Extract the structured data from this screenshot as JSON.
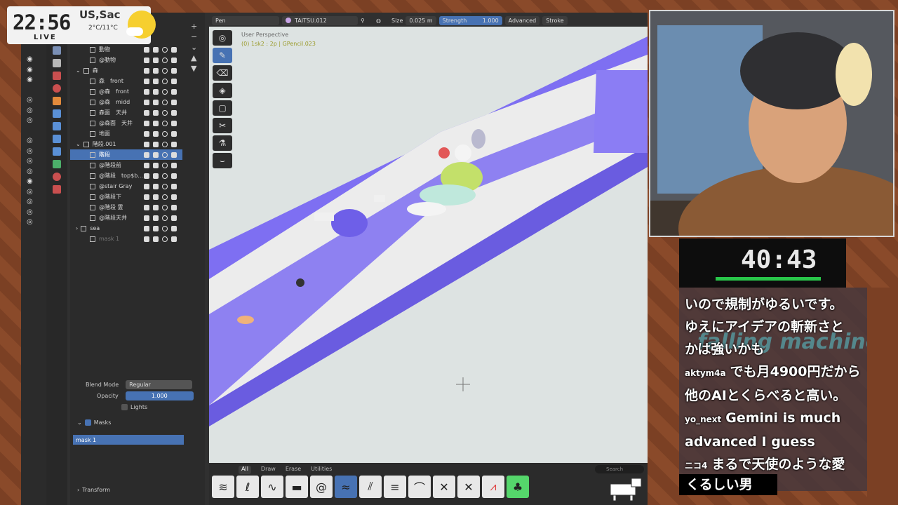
{
  "overlay": {
    "time": "22:56",
    "live": "LIVE",
    "location": "US,Sac",
    "temp": "2°C/11°C",
    "timer": "40:43",
    "progress": 0.75
  },
  "outliner": {
    "rows": [
      {
        "indent": 1,
        "label": "動物",
        "dim": false,
        "sel": false
      },
      {
        "indent": 1,
        "label": "@動物",
        "dim": false,
        "sel": false
      },
      {
        "indent": 0,
        "label": "森",
        "dim": false,
        "sel": false,
        "expand": "v"
      },
      {
        "indent": 1,
        "label": "森　front",
        "dim": false,
        "sel": false
      },
      {
        "indent": 1,
        "label": "@森　front",
        "dim": false,
        "sel": false
      },
      {
        "indent": 1,
        "label": "@森　midd",
        "dim": false,
        "sel": false
      },
      {
        "indent": 1,
        "label": "森面　天井",
        "dim": false,
        "sel": false
      },
      {
        "indent": 1,
        "label": "@森面　天井",
        "dim": false,
        "sel": false
      },
      {
        "indent": 1,
        "label": "地面",
        "dim": false,
        "sel": false
      },
      {
        "indent": 0,
        "label": "階段.001",
        "dim": false,
        "sel": false,
        "expand": "v"
      },
      {
        "indent": 1,
        "label": "階段",
        "dim": false,
        "sel": true
      },
      {
        "indent": 1,
        "label": "@階段前",
        "dim": false,
        "sel": false
      },
      {
        "indent": 1,
        "label": "@階段　top$b...",
        "dim": false,
        "sel": false
      },
      {
        "indent": 1,
        "label": "@stair Gray",
        "dim": false,
        "sel": false
      },
      {
        "indent": 1,
        "label": "@階段下",
        "dim": false,
        "sel": false
      },
      {
        "indent": 1,
        "label": "@階段 霊",
        "dim": false,
        "sel": false
      },
      {
        "indent": 1,
        "label": "@階段天井",
        "dim": false,
        "sel": false
      },
      {
        "indent": 0,
        "label": "sea",
        "dim": false,
        "sel": false,
        "expand": ">"
      },
      {
        "indent": 1,
        "label": "mask 1",
        "dim": true,
        "sel": false
      }
    ]
  },
  "props": {
    "blend_mode_label": "Blend Mode",
    "blend_mode_value": "Regular",
    "opacity_label": "Opacity",
    "opacity_value": "1.000",
    "lights_label": "Lights",
    "masks_label": "Masks",
    "mask_item": "mask 1",
    "transform_label": "Transform"
  },
  "header": {
    "tool": "Pen",
    "material": "TAITSU.012",
    "size_label": "Size",
    "size_value": "0.025 m",
    "strength_label": "Strength",
    "strength_value": "1.000",
    "advanced": "Advanced",
    "stroke": "Stroke"
  },
  "viewport": {
    "perspective": "User Perspective",
    "object": "(0) 1sk2 : 2p | GPencil.023"
  },
  "brushbar": {
    "tabs": [
      "All",
      "Draw",
      "Erase",
      "Utilities"
    ],
    "search_placeholder": "Search"
  },
  "chat": {
    "lines": [
      {
        "user": "",
        "text": "いので規制がゆるいです。"
      },
      {
        "user": "",
        "text": "ゆえにアイデアの斬新さと"
      },
      {
        "user": "",
        "text": "かは強いかも"
      },
      {
        "user": "aktym4a",
        "text": "でも月4900円だから"
      },
      {
        "user": "",
        "text": "他のAIとくらべると高い。"
      },
      {
        "user": "yo_next",
        "text": "Gemini is much"
      },
      {
        "user": "",
        "text": "advanced I guess"
      },
      {
        "user": "ニコ4",
        "text": "まるで天使のような愛"
      }
    ],
    "last": "くるしい男",
    "watermark": "falling machine"
  }
}
